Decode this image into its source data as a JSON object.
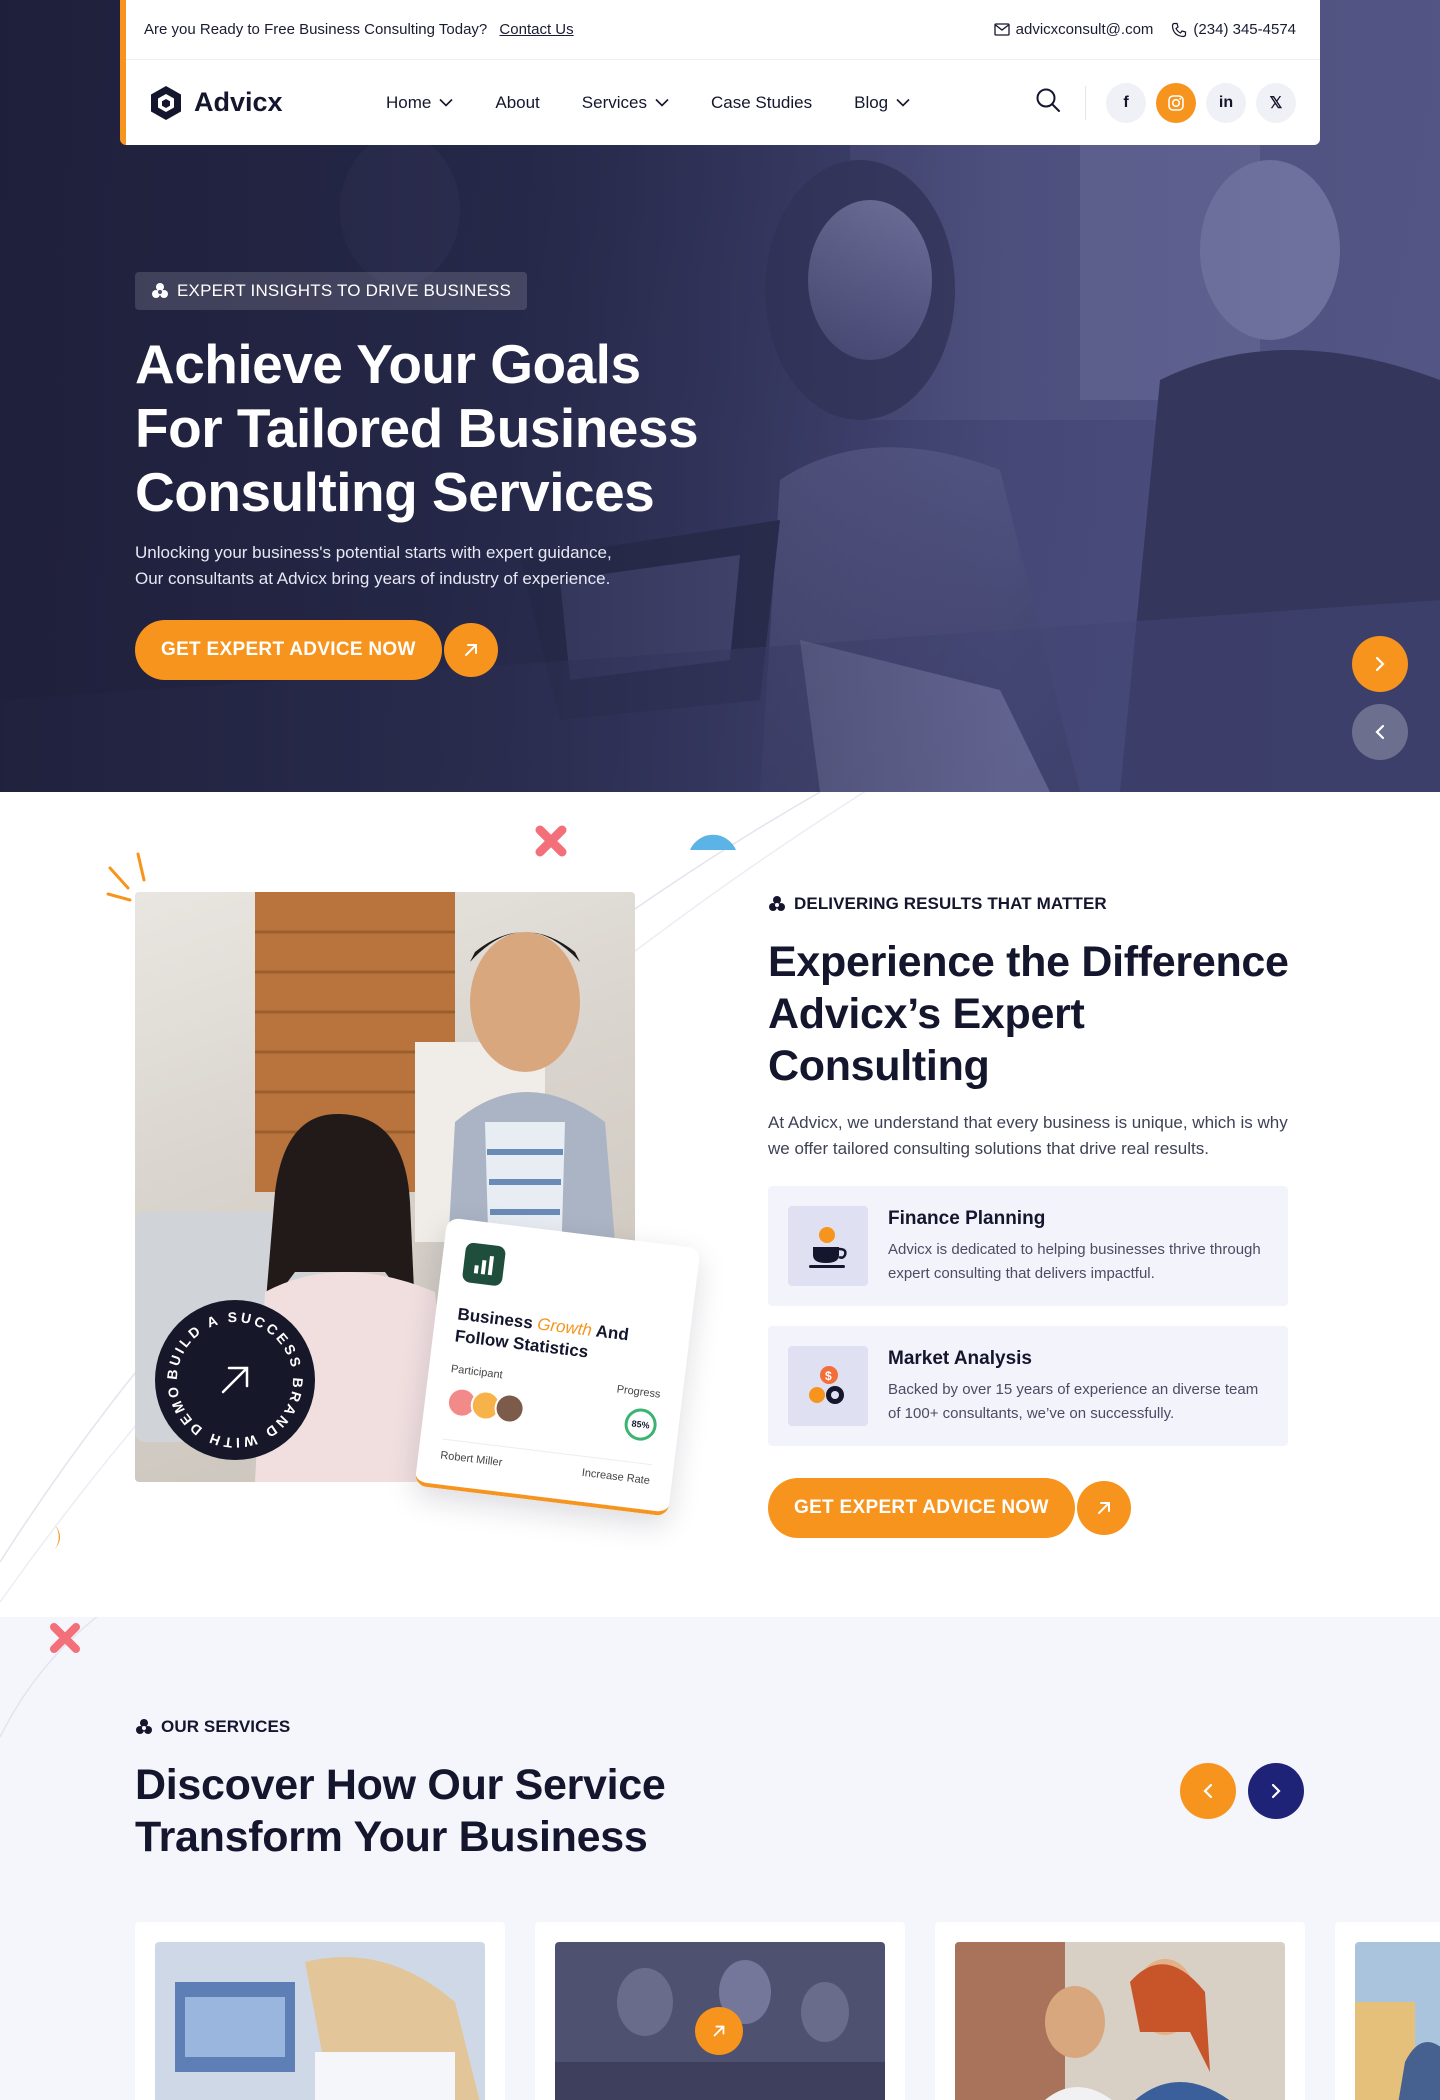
{
  "topbar": {
    "promo_text": "Are you Ready to Free Business Consulting Today?",
    "contact_link": "Contact Us",
    "email": "advicxconsult@.com",
    "phone": "(234) 345-4574"
  },
  "brand": {
    "name": "Advicx"
  },
  "nav": {
    "items": [
      {
        "label": "Home",
        "has_dropdown": true
      },
      {
        "label": "About",
        "has_dropdown": false
      },
      {
        "label": "Services",
        "has_dropdown": true
      },
      {
        "label": "Case Studies",
        "has_dropdown": false
      },
      {
        "label": "Blog",
        "has_dropdown": true
      }
    ],
    "social": [
      "f",
      "instagram",
      "in",
      "𝕏"
    ]
  },
  "hero": {
    "tag": "EXPERT INSIGHTS TO DRIVE BUSINESS",
    "title_lines": [
      "Achieve Your Goals",
      "For Tailored Business",
      "Consulting Services"
    ],
    "desc_lines": [
      "Unlocking your business's potential starts with expert guidance,",
      "Our consultants at Advicx bring years of industry of experience."
    ],
    "cta": "GET EXPERT ADVICE NOW"
  },
  "about": {
    "badge_text": "BUILD A SUCCESS BRAND WITH DEMOUI",
    "stats_card": {
      "title_a": "Business",
      "title_b": "Growth",
      "title_c": "And Follow Statistics",
      "participant": "Participant",
      "progress": "Progress",
      "progress_value": "85%",
      "person": "Robert Miller",
      "increase": "Increase Rate"
    },
    "tag": "DELIVERING RESULTS THAT MATTER",
    "title_lines": [
      "Experience the Difference",
      "Advicx’s Expert Consulting"
    ],
    "desc": "At Advicx, we understand that every business is unique, which is why we offer tailored consulting solutions that drive real results.",
    "features": [
      {
        "title": "Finance Planning",
        "desc": "Advicx is dedicated to helping businesses thrive through expert consulting that delivers impactful."
      },
      {
        "title": "Market Analysis",
        "desc": "Backed by over 15 years of experience an diverse team of 100+ consultants, we’ve on successfully."
      }
    ],
    "cta": "GET EXPERT ADVICE NOW"
  },
  "services": {
    "tag": "OUR SERVICES",
    "title_lines": [
      "Discover How Our Service",
      "Transform Your Business"
    ]
  },
  "colors": {
    "accent": "#f7941d",
    "navy": "#1f2378",
    "ink": "#14162e",
    "soft_bg": "#f5f5fc"
  }
}
